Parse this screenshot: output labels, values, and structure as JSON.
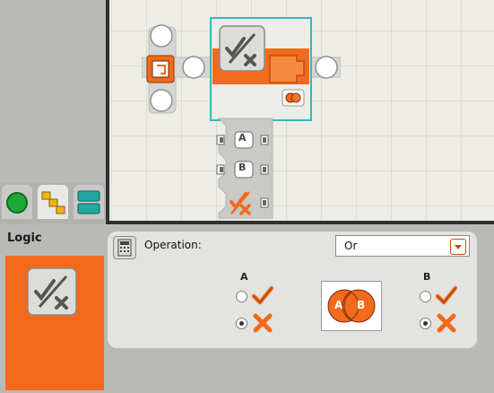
{
  "palette": {
    "tabs": [
      {
        "name": "common-palette",
        "icon": "green-circle-icon"
      },
      {
        "name": "complete-palette",
        "icon": "yellow-blocks-icon",
        "active": true
      },
      {
        "name": "custom-palette",
        "icon": "teal-stack-icon"
      }
    ]
  },
  "canvas": {
    "logic_block": {
      "plugs": [
        "A",
        "B"
      ],
      "selected": true
    }
  },
  "config": {
    "block_name": "Logic",
    "operation_label": "Operation:",
    "operation_value": "Or",
    "col_a_label": "A",
    "col_b_label": "B",
    "a_value": "false",
    "b_value": "false",
    "venn_left": "A",
    "venn_right": "B"
  },
  "colors": {
    "accent": "#f36a1c",
    "selection": "#35b8b8",
    "panel": "#b9b9b7"
  }
}
